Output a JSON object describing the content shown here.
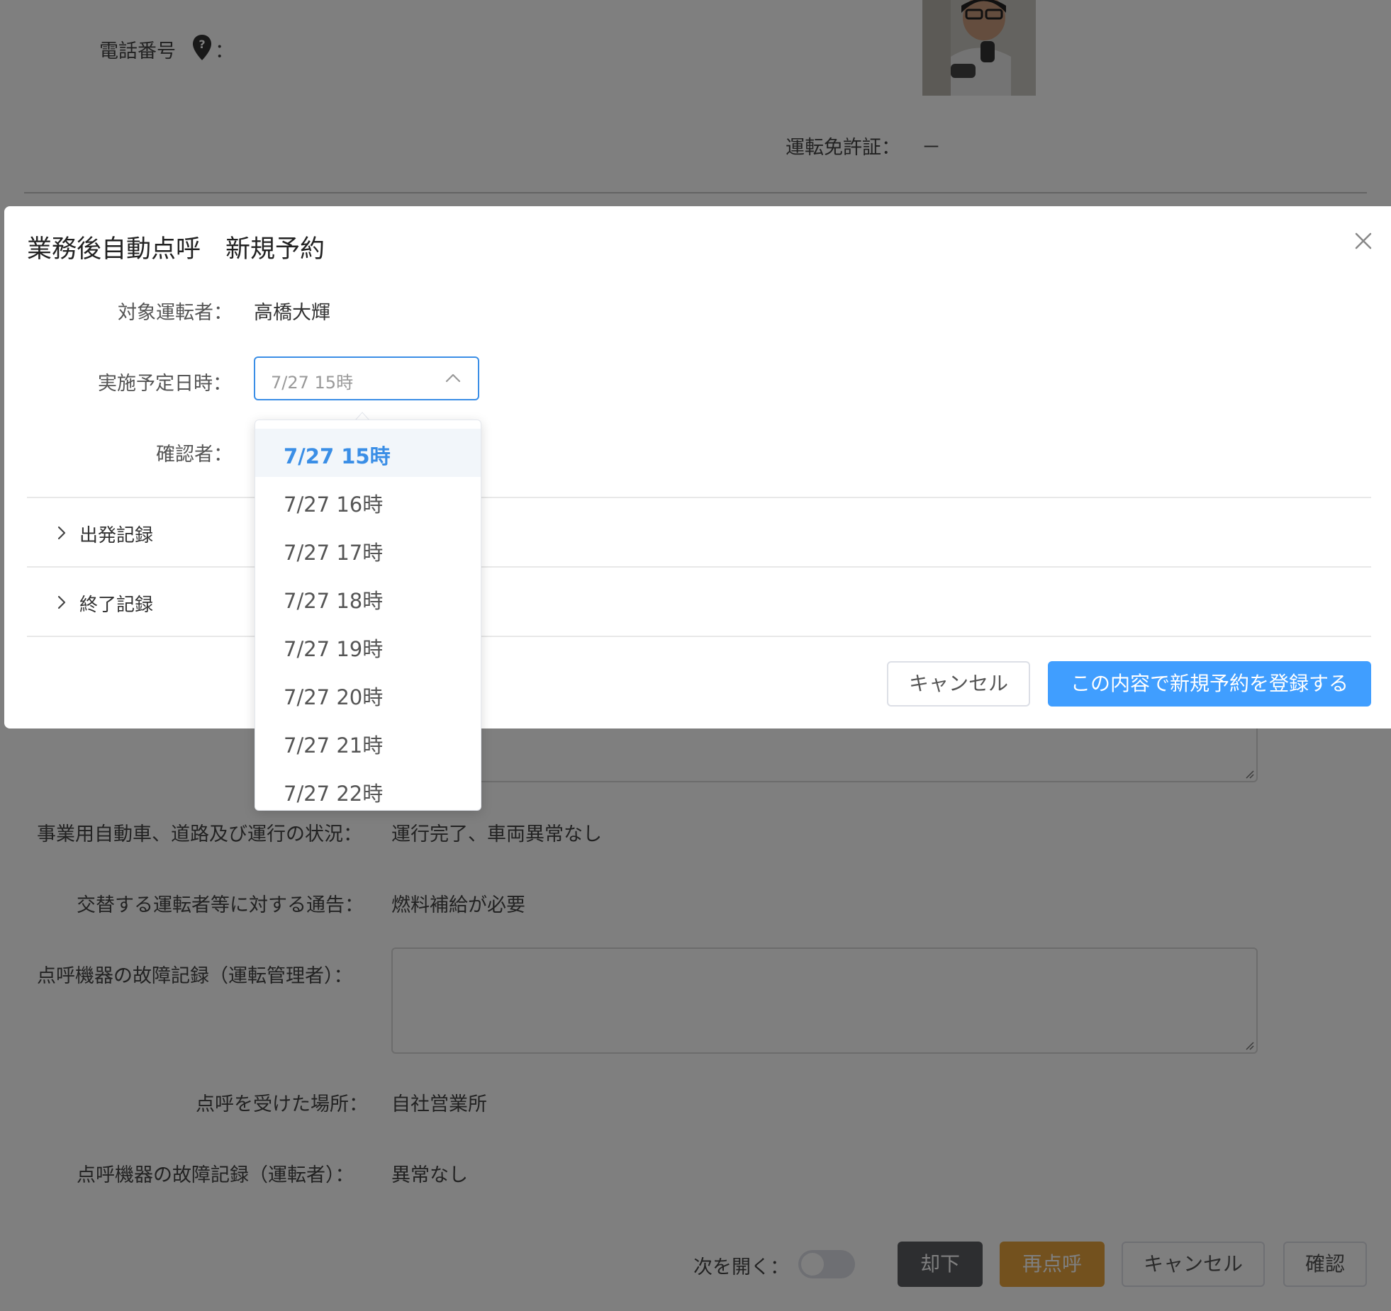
{
  "background": {
    "phone_label": "電話番号",
    "phone_colon": "：",
    "license_label": "運転免許証：",
    "license_value": "－",
    "road_status_label": "事業用自動車、道路及び運行の状況：",
    "road_status_value": "運行完了、車両異常なし",
    "handover_label": "交替する運転者等に対する通告：",
    "handover_value": "燃料補給が必要",
    "device_fault_manager_label": "点呼機器の故障記録（運転管理者）：",
    "place_label": "点呼を受けた場所：",
    "place_value": "自社営業所",
    "device_fault_driver_label": "点呼機器の故障記録（運転者）：",
    "device_fault_driver_value": "異常なし",
    "open_next_label": "次を開く：",
    "open_next_on": false,
    "reject_label": "却下",
    "recall_label": "再点呼",
    "cancel_label": "キャンセル",
    "confirm_label": "確認",
    "colors": {
      "reject": "#5a5c61",
      "recall": "#e6a23c"
    }
  },
  "modal": {
    "title": "業務後自動点呼　新規予約",
    "driver_label": "対象運転者：",
    "driver_value": "高橋大輝",
    "datetime_label": "実施予定日時：",
    "datetime_value": "7/27 15時",
    "confirmer_label": "確認者：",
    "sections": [
      {
        "label": "出発記録",
        "expanded": false
      },
      {
        "label": "終了記録",
        "expanded": false
      }
    ],
    "cancel_label": "キャンセル",
    "submit_label": "この内容で新規予約を登録する",
    "colors": {
      "primary": "#409eff"
    }
  },
  "dropdown": {
    "options": [
      "7/27 15時",
      "7/27 16時",
      "7/27 17時",
      "7/27 18時",
      "7/27 19時",
      "7/27 20時",
      "7/27 21時",
      "7/27 22時"
    ],
    "selected_index": 0
  }
}
